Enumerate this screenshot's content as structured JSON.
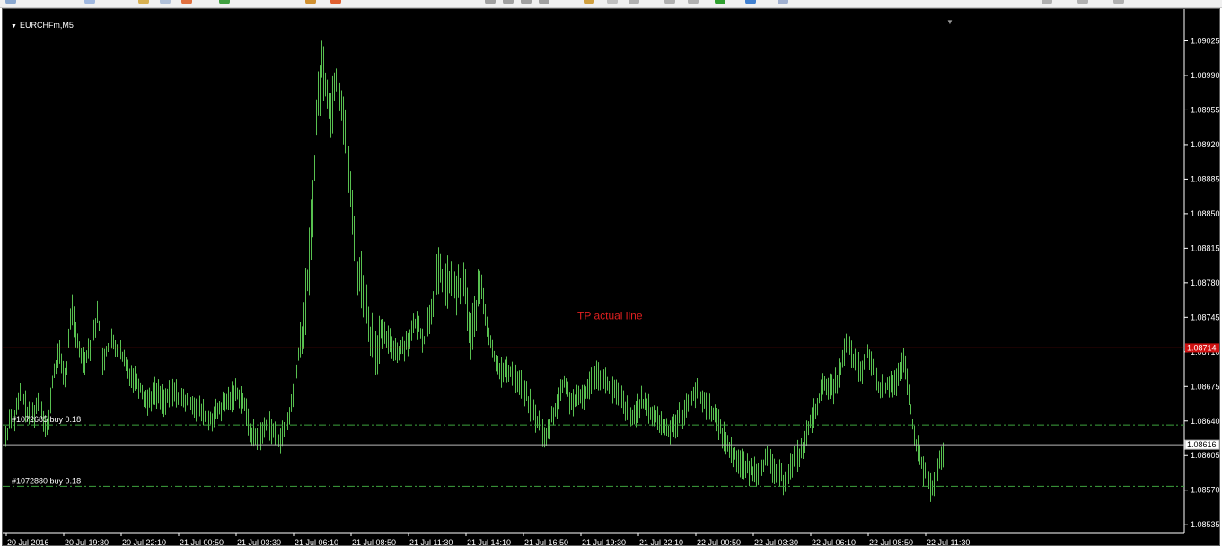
{
  "window": {
    "symbol_title": "EURCHFm,M5"
  },
  "colors": {
    "background": "#000000",
    "candles": "#58c050",
    "axis": "#ffffff",
    "tp_line": "#d01010",
    "order_line": "#3ea23e",
    "bid_line": "#b8b8b8",
    "tp_label": "#e02020"
  },
  "icons": [
    "toolbar-icon",
    "chevron-down-icon"
  ],
  "chart_data": {
    "type": "candlestick",
    "symbol": "EURCHFm",
    "timeframe": "M5",
    "ylim": [
      1.08527,
      1.0905
    ],
    "y_ticks": [
      "1.09025",
      "1.08990",
      "1.08955",
      "1.08920",
      "1.08885",
      "1.08850",
      "1.08815",
      "1.08780",
      "1.08745",
      "1.08710",
      "1.08675",
      "1.08640",
      "1.08605",
      "1.08570",
      "1.08535"
    ],
    "x_ticks": [
      "20 Jul 2016",
      "20 Jul 19:30",
      "20 Jul 22:10",
      "21 Jul 00:50",
      "21 Jul 03:30",
      "21 Jul 06:10",
      "21 Jul 08:50",
      "21 Jul 11:30",
      "21 Jul 14:10",
      "21 Jul 16:50",
      "21 Jul 19:30",
      "21 Jul 22:10",
      "22 Jul 00:50",
      "22 Jul 03:30",
      "22 Jul 06:10",
      "22 Jul 08:50",
      "22 Jul 11:30"
    ],
    "price_path": [
      [
        0,
        1.0864
      ],
      [
        4,
        1.0862
      ],
      [
        8,
        1.0865
      ],
      [
        12,
        1.0864
      ],
      [
        20,
        1.0867
      ],
      [
        30,
        1.0864
      ],
      [
        40,
        1.0866
      ],
      [
        50,
        1.0863
      ],
      [
        55,
        1.0868
      ],
      [
        62,
        1.0871
      ],
      [
        70,
        1.0868
      ],
      [
        76,
        1.0876
      ],
      [
        82,
        1.0872
      ],
      [
        90,
        1.087
      ],
      [
        98,
        1.0872
      ],
      [
        106,
        1.0875
      ],
      [
        110,
        1.087
      ],
      [
        120,
        1.0872
      ],
      [
        130,
        1.0871
      ],
      [
        140,
        1.0869
      ],
      [
        150,
        1.0868
      ],
      [
        160,
        1.0866
      ],
      [
        170,
        1.0867
      ],
      [
        180,
        1.0866
      ],
      [
        190,
        1.0867
      ],
      [
        200,
        1.0866
      ],
      [
        210,
        1.0866
      ],
      [
        220,
        1.0865
      ],
      [
        230,
        1.0864
      ],
      [
        240,
        1.0865
      ],
      [
        250,
        1.0866
      ],
      [
        260,
        1.0867
      ],
      [
        268,
        1.0866
      ],
      [
        275,
        1.0863
      ],
      [
        285,
        1.0862
      ],
      [
        295,
        1.0864
      ],
      [
        305,
        1.0862
      ],
      [
        315,
        1.0863
      ],
      [
        322,
        1.0866
      ],
      [
        328,
        1.087
      ],
      [
        334,
        1.0873
      ],
      [
        340,
        1.0879
      ],
      [
        345,
        1.0886
      ],
      [
        350,
        1.0896
      ],
      [
        355,
        1.09
      ],
      [
        360,
        1.0898
      ],
      [
        365,
        1.0895
      ],
      [
        370,
        1.0899
      ],
      [
        378,
        1.0896
      ],
      [
        385,
        1.089
      ],
      [
        390,
        1.0883
      ],
      [
        395,
        1.0879
      ],
      [
        400,
        1.0878
      ],
      [
        408,
        1.0873
      ],
      [
        415,
        1.0871
      ],
      [
        420,
        1.0873
      ],
      [
        430,
        1.0872
      ],
      [
        440,
        1.0871
      ],
      [
        450,
        1.0872
      ],
      [
        460,
        1.0874
      ],
      [
        470,
        1.0872
      ],
      [
        478,
        1.0876
      ],
      [
        485,
        1.0879
      ],
      [
        492,
        1.0878
      ],
      [
        500,
        1.0878
      ],
      [
        508,
        1.0877
      ],
      [
        515,
        1.0878
      ],
      [
        520,
        1.0872
      ],
      [
        526,
        1.0875
      ],
      [
        532,
        1.0878
      ],
      [
        538,
        1.0874
      ],
      [
        545,
        1.0871
      ],
      [
        555,
        1.0869
      ],
      [
        565,
        1.0869
      ],
      [
        575,
        1.0868
      ],
      [
        585,
        1.0866
      ],
      [
        595,
        1.0864
      ],
      [
        605,
        1.0862
      ],
      [
        610,
        1.0864
      ],
      [
        618,
        1.0866
      ],
      [
        625,
        1.0868
      ],
      [
        632,
        1.0866
      ],
      [
        640,
        1.0866
      ],
      [
        650,
        1.0867
      ],
      [
        660,
        1.0869
      ],
      [
        670,
        1.0868
      ],
      [
        680,
        1.0867
      ],
      [
        690,
        1.0866
      ],
      [
        700,
        1.0864
      ],
      [
        710,
        1.0866
      ],
      [
        720,
        1.0865
      ],
      [
        730,
        1.0864
      ],
      [
        740,
        1.0863
      ],
      [
        750,
        1.0864
      ],
      [
        760,
        1.0865
      ],
      [
        770,
        1.0867
      ],
      [
        780,
        1.0866
      ],
      [
        790,
        1.0865
      ],
      [
        800,
        1.0863
      ],
      [
        810,
        1.0861
      ],
      [
        820,
        1.086
      ],
      [
        830,
        1.0859
      ],
      [
        840,
        1.0859
      ],
      [
        850,
        1.086
      ],
      [
        860,
        1.0859
      ],
      [
        870,
        1.0858
      ],
      [
        880,
        1.086
      ],
      [
        890,
        1.0861
      ],
      [
        900,
        1.0864
      ],
      [
        908,
        1.0866
      ],
      [
        916,
        1.0868
      ],
      [
        924,
        1.0867
      ],
      [
        932,
        1.0869
      ],
      [
        940,
        1.0872
      ],
      [
        948,
        1.087
      ],
      [
        956,
        1.0869
      ],
      [
        964,
        1.0871
      ],
      [
        972,
        1.0868
      ],
      [
        980,
        1.0867
      ],
      [
        988,
        1.0868
      ],
      [
        996,
        1.0868
      ],
      [
        1004,
        1.087
      ],
      [
        1010,
        1.0866
      ],
      [
        1015,
        1.0862
      ],
      [
        1020,
        1.0861
      ],
      [
        1025,
        1.0859
      ],
      [
        1030,
        1.0858
      ],
      [
        1035,
        1.0857
      ],
      [
        1040,
        1.0859
      ],
      [
        1045,
        1.086
      ],
      [
        1050,
        1.0861
      ]
    ],
    "horizontal_lines": [
      {
        "name": "TP actual line",
        "price": 1.08714,
        "style": "solid",
        "price_label": "1.08714"
      },
      {
        "name": "#1072685 buy 0.18",
        "price": 1.08636,
        "style": "dash-dot"
      },
      {
        "name": "#1072880 buy 0.18",
        "price": 1.08574,
        "style": "dash-dot"
      },
      {
        "name": "bid",
        "price": 1.08616,
        "style": "solid",
        "price_label": "1.08616"
      }
    ],
    "labels": {
      "tp_text": "TP actual line",
      "order1": "#1072685 buy 0.18",
      "order2": "#1072880 buy 0.18",
      "tp_price": "1.08714",
      "bid_price": "1.08616"
    }
  }
}
